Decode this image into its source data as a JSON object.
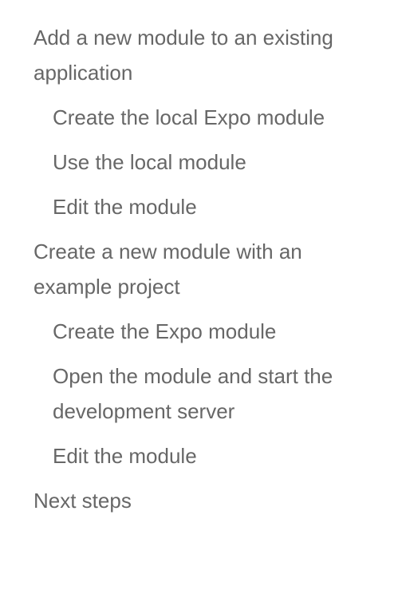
{
  "toc": {
    "sections": [
      {
        "label": "Add a new module to an existing application",
        "children": [
          {
            "label": "Create the local Expo module"
          },
          {
            "label": "Use the local module"
          },
          {
            "label": "Edit the module"
          }
        ]
      },
      {
        "label": "Create a new module with an example project",
        "children": [
          {
            "label": "Create the Expo module"
          },
          {
            "label": "Open the module and start the development server"
          },
          {
            "label": "Edit the module"
          }
        ]
      },
      {
        "label": "Next steps",
        "children": []
      }
    ]
  }
}
